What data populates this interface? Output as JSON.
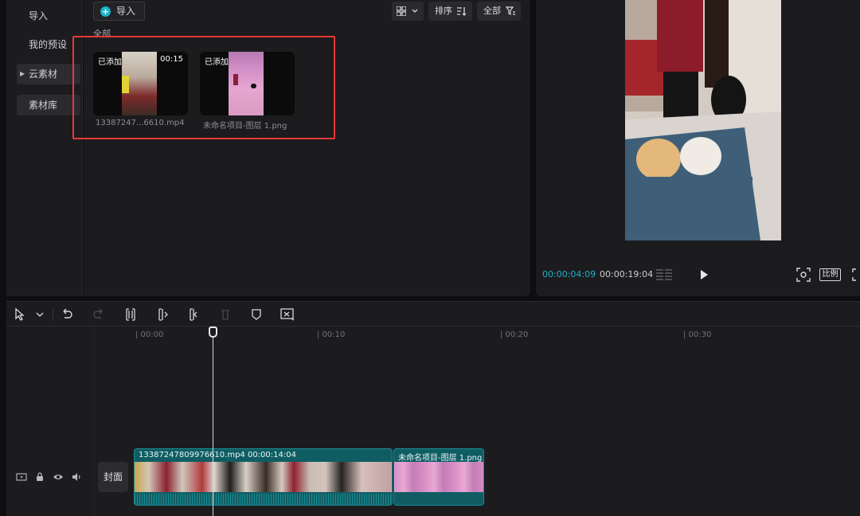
{
  "left_nav": {
    "import_label": "导入",
    "presets_label": "我的预设",
    "cloud_label": "云素材",
    "library_label": "素材库"
  },
  "media": {
    "import_button": "导入",
    "sort_label": "排序",
    "filter_label": "全部",
    "section_label": "全部",
    "items": [
      {
        "added_badge": "已添加",
        "duration": "00:15",
        "filename": "13387247...6610.mp4"
      },
      {
        "added_badge": "已添加",
        "duration": "",
        "filename": "未命名项目-图层 1.png"
      }
    ]
  },
  "preview": {
    "current_time": "00:00:04:09",
    "total_time": "00:00:19:04",
    "ratio_label": "比例"
  },
  "timeline": {
    "ruler": [
      "| 00:00",
      "| 00:10",
      "| 00:20",
      "| 00:30"
    ],
    "cover_label": "封面",
    "clips": [
      {
        "label": "13387247809976610.mp4   00:00:14:04"
      },
      {
        "label": "未命名项目-图层 1.png"
      }
    ]
  },
  "colors": {
    "accent": "#19b3c9",
    "highlight_box": "#e53935",
    "clip_bg": "#0f5d63"
  }
}
